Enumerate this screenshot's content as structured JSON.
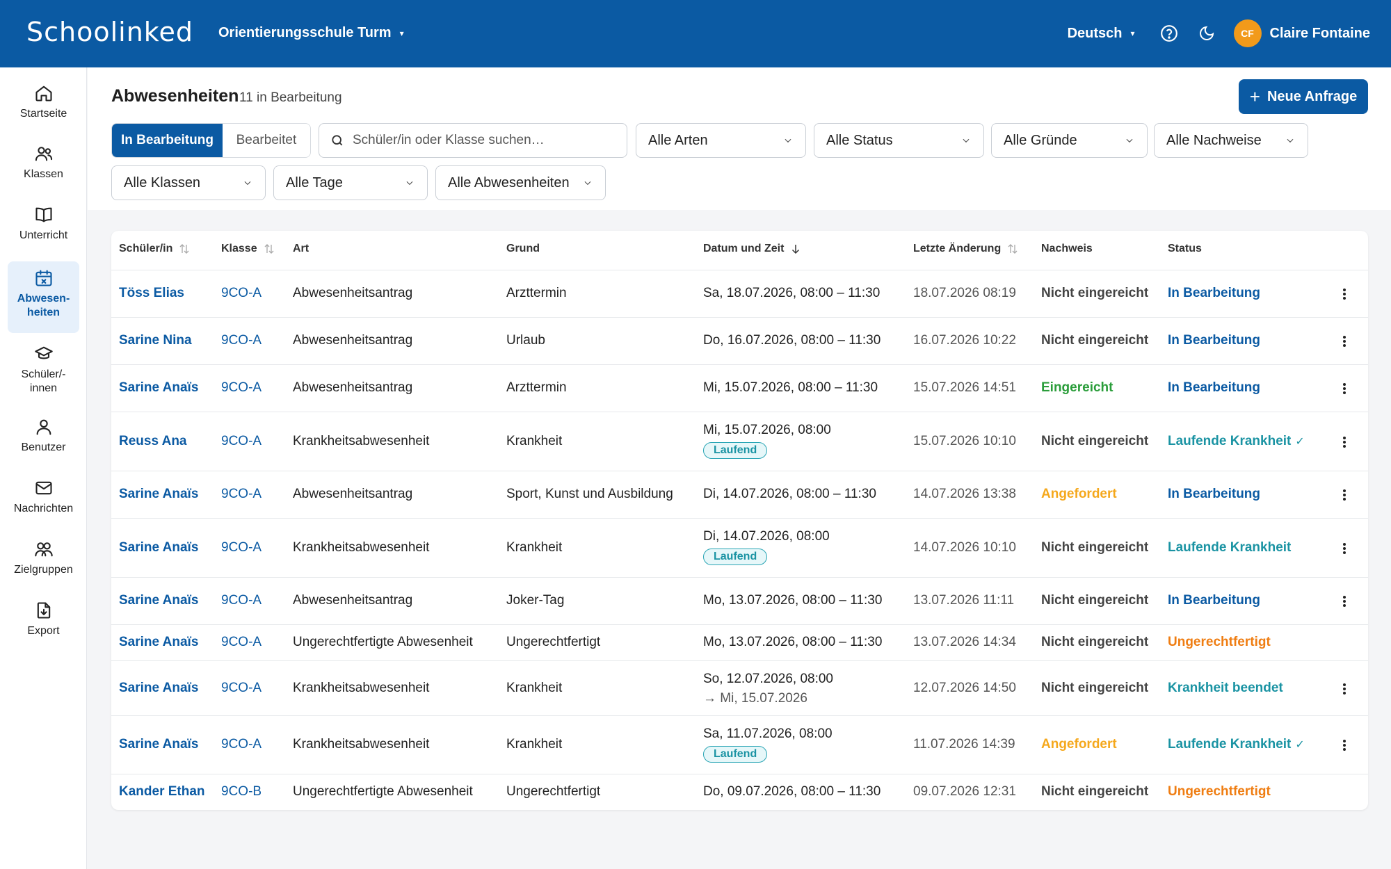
{
  "colors": {
    "brand": "#0b5aa3",
    "green": "#2a9d3a",
    "amber": "#f5a81c",
    "teal": "#1a93a3",
    "orange": "#ef7d12"
  },
  "header": {
    "logo": "Schoolinked",
    "school": "Orientierungsschule Turm",
    "language": "Deutsch",
    "avatar_initials": "CF",
    "user_name": "Claire Fontaine"
  },
  "sidebar": {
    "items": [
      {
        "label": "Startseite",
        "icon": "home-icon"
      },
      {
        "label": "Klassen",
        "icon": "users-icon"
      },
      {
        "label": "Unterricht",
        "icon": "book-icon"
      },
      {
        "label": "Abwesen-\nheiten",
        "icon": "calendar-x-icon"
      },
      {
        "label": "Schüler/-\ninnen",
        "icon": "graduation-cap-icon"
      },
      {
        "label": "Benutzer",
        "icon": "user-icon"
      },
      {
        "label": "Nachrichten",
        "icon": "mail-icon"
      },
      {
        "label": "Zielgruppen",
        "icon": "group-icon"
      },
      {
        "label": "Export",
        "icon": "file-export-icon"
      }
    ]
  },
  "page": {
    "title": "Abwesenheiten",
    "count": "11 in Bearbeitung",
    "new_button": "Neue Anfrage"
  },
  "filters": {
    "seg_on": "In Bearbeitung",
    "seg_off": "Bearbeitet",
    "search_placeholder": "Schüler/in oder Klasse suchen…",
    "arten": "Alle Arten",
    "status": "Alle Status",
    "gruende": "Alle Gründe",
    "nachweise": "Alle Nachweise",
    "klassen": "Alle Klassen",
    "tage": "Alle Tage",
    "abwesenheiten": "Alle Abwesenheiten"
  },
  "table": {
    "headers": {
      "schueler": "Schüler/in",
      "klasse": "Klasse",
      "art": "Art",
      "grund": "Grund",
      "datum": "Datum und Zeit",
      "letzte": "Letzte Änderung",
      "nachweis": "Nachweis",
      "status": "Status"
    },
    "rows": [
      {
        "name": "Töss Elias",
        "klasse": "9CO-A",
        "art": "Abwesenheitsantrag",
        "grund": "Arzttermin",
        "datum": "Sa, 18.07.2026, 08:00 – 11:30",
        "datum2": "",
        "badge": "",
        "letzte": "18.07.2026 08:19",
        "nachweis": "Nicht eingereicht",
        "nachweis_color": "default",
        "status": "In Bearbeitung",
        "status_color": "brand",
        "check": "",
        "menu": true
      },
      {
        "name": "Sarine Nina",
        "klasse": "9CO-A",
        "art": "Abwesenheitsantrag",
        "grund": "Urlaub",
        "datum": "Do, 16.07.2026, 08:00 – 11:30",
        "datum2": "",
        "badge": "",
        "letzte": "16.07.2026 10:22",
        "nachweis": "Nicht eingereicht",
        "nachweis_color": "default",
        "status": "In Bearbeitung",
        "status_color": "brand",
        "check": "",
        "menu": true
      },
      {
        "name": "Sarine Anaïs",
        "klasse": "9CO-A",
        "art": "Abwesenheitsantrag",
        "grund": "Arzttermin",
        "datum": "Mi, 15.07.2026, 08:00 – 11:30",
        "datum2": "",
        "badge": "",
        "letzte": "15.07.2026 14:51",
        "nachweis": "Eingereicht",
        "nachweis_color": "green",
        "status": "In Bearbeitung",
        "status_color": "brand",
        "check": "",
        "menu": true
      },
      {
        "name": "Reuss Ana",
        "klasse": "9CO-A",
        "art": "Krankheitsabwesenheit",
        "grund": "Krankheit",
        "datum": "Mi, 15.07.2026, 08:00",
        "datum2": "",
        "badge": "Laufend",
        "letzte": "15.07.2026 10:10",
        "nachweis": "Nicht eingereicht",
        "nachweis_color": "default",
        "status": "Laufende Krankheit",
        "status_color": "teal",
        "check": "✓",
        "menu": true
      },
      {
        "name": "Sarine Anaïs",
        "klasse": "9CO-A",
        "art": "Abwesenheitsantrag",
        "grund": "Sport, Kunst und Ausbildung",
        "datum": "Di, 14.07.2026, 08:00 – 11:30",
        "datum2": "",
        "badge": "",
        "letzte": "14.07.2026 13:38",
        "nachweis": "Angefordert",
        "nachweis_color": "amber",
        "status": "In Bearbeitung",
        "status_color": "brand",
        "check": "",
        "menu": true
      },
      {
        "name": "Sarine Anaïs",
        "klasse": "9CO-A",
        "art": "Krankheitsabwesenheit",
        "grund": "Krankheit",
        "datum": "Di, 14.07.2026, 08:00",
        "datum2": "",
        "badge": "Laufend",
        "letzte": "14.07.2026 10:10",
        "nachweis": "Nicht eingereicht",
        "nachweis_color": "default",
        "status": "Laufende Krankheit",
        "status_color": "teal",
        "check": "",
        "menu": true
      },
      {
        "name": "Sarine Anaïs",
        "klasse": "9CO-A",
        "art": "Abwesenheitsantrag",
        "grund": "Joker-Tag",
        "datum": "Mo, 13.07.2026, 08:00 – 11:30",
        "datum2": "",
        "badge": "",
        "letzte": "13.07.2026 11:11",
        "nachweis": "Nicht eingereicht",
        "nachweis_color": "default",
        "status": "In Bearbeitung",
        "status_color": "brand",
        "check": "",
        "menu": true
      },
      {
        "name": "Sarine Anaïs",
        "klasse": "9CO-A",
        "art": "Ungerechtfertigte Abwesenheit",
        "grund": "Ungerechtfertigt",
        "datum": "Mo, 13.07.2026, 08:00 – 11:30",
        "datum2": "",
        "badge": "",
        "letzte": "13.07.2026 14:34",
        "nachweis": "Nicht eingereicht",
        "nachweis_color": "default",
        "status": "Ungerechtfertigt",
        "status_color": "orange",
        "check": "",
        "menu": false
      },
      {
        "name": "Sarine Anaïs",
        "klasse": "9CO-A",
        "art": "Krankheitsabwesenheit",
        "grund": "Krankheit",
        "datum": "So, 12.07.2026, 08:00",
        "datum2": "→ Mi, 15.07.2026",
        "badge": "",
        "letzte": "12.07.2026 14:50",
        "nachweis": "Nicht eingereicht",
        "nachweis_color": "default",
        "status": "Krankheit beendet",
        "status_color": "teal",
        "check": "",
        "menu": true
      },
      {
        "name": "Sarine Anaïs",
        "klasse": "9CO-A",
        "art": "Krankheitsabwesenheit",
        "grund": "Krankheit",
        "datum": "Sa, 11.07.2026, 08:00",
        "datum2": "",
        "badge": "Laufend",
        "letzte": "11.07.2026 14:39",
        "nachweis": "Angefordert",
        "nachweis_color": "amber",
        "status": "Laufende Krankheit",
        "status_color": "teal",
        "check": "✓",
        "menu": true
      },
      {
        "name": "Kander Ethan",
        "klasse": "9CO-B",
        "art": "Ungerechtfertigte Abwesenheit",
        "grund": "Ungerechtfertigt",
        "datum": "Do, 09.07.2026, 08:00 – 11:30",
        "datum2": "",
        "badge": "",
        "letzte": "09.07.2026 12:31",
        "nachweis": "Nicht eingereicht",
        "nachweis_color": "default",
        "status": "Ungerechtfertigt",
        "status_color": "orange",
        "check": "",
        "menu": false
      }
    ]
  }
}
